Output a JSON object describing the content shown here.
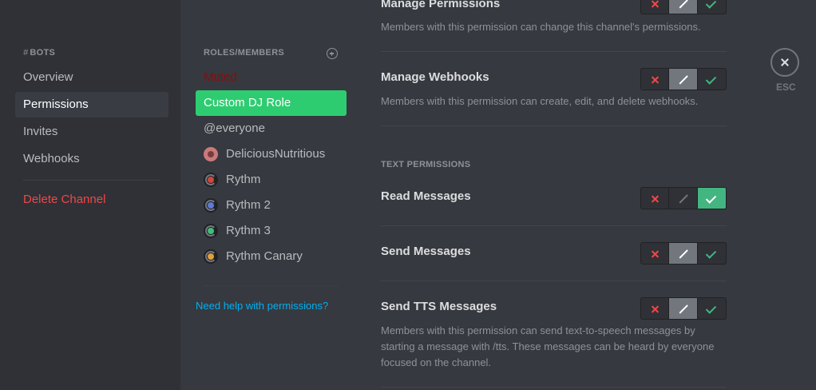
{
  "sidebar": {
    "header_hash": "#",
    "header": "BOTS",
    "items": [
      {
        "label": "Overview"
      },
      {
        "label": "Permissions"
      },
      {
        "label": "Invites"
      },
      {
        "label": "Webhooks"
      }
    ],
    "delete_label": "Delete Channel"
  },
  "roles": {
    "header": "ROLES/MEMBERS",
    "add_icon": "plus-circle-icon",
    "items": [
      {
        "label": "Muted",
        "color": "#8b0c0c"
      },
      {
        "label": "Custom DJ Role",
        "color": "#2ecc71"
      },
      {
        "label": "@everyone"
      }
    ],
    "members": [
      {
        "label": "DeliciousNutritious",
        "avatar_color": "#c97a7a"
      },
      {
        "label": "Rythm",
        "avatar_color": "#d0463c"
      },
      {
        "label": "Rythm 2",
        "avatar_color": "#5c7cd6"
      },
      {
        "label": "Rythm 3",
        "avatar_color": "#3fbf77"
      },
      {
        "label": "Rythm Canary",
        "avatar_color": "#e0a040"
      }
    ],
    "help_link": "Need help with permissions?"
  },
  "permissions": [
    {
      "title": "Manage Permissions",
      "desc": "Members with this permission can change this channel's permissions.",
      "state": "neutral"
    },
    {
      "title": "Manage Webhooks",
      "desc": "Members with this permission can create, edit, and delete webhooks.",
      "state": "neutral"
    }
  ],
  "text_section": {
    "title": "TEXT PERMISSIONS",
    "items": [
      {
        "title": "Read Messages",
        "state": "allow"
      },
      {
        "title": "Send Messages",
        "state": "neutral"
      },
      {
        "title": "Send TTS Messages",
        "desc": "Members with this permission can send text-to-speech messages by starting a message with /tts. These messages can be heard by everyone focused on the channel.",
        "state": "neutral"
      }
    ]
  },
  "close": {
    "icon": "close-icon",
    "label": "ESC"
  },
  "colors": {
    "deny": "#f04747",
    "allow": "#43b581",
    "link": "#00b0f4"
  }
}
